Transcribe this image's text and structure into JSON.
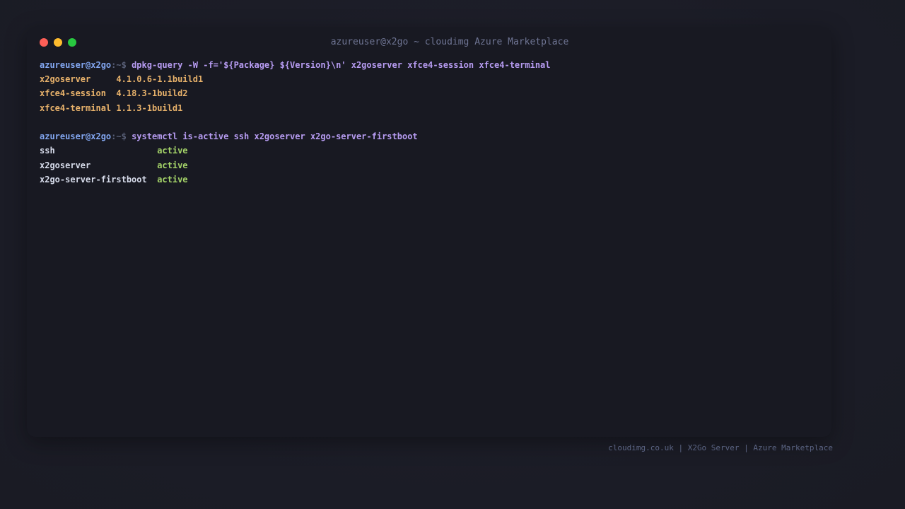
{
  "window": {
    "title": "azureuser@x2go ~ cloudimg Azure Marketplace",
    "controls": {
      "close_color": "#fe5f57",
      "minimize_color": "#febc2e",
      "maximize_color": "#28c840"
    }
  },
  "terminal": {
    "prompt_user": "azureuser@x2go",
    "prompt_path": ":~$",
    "command_1": "dpkg-query -W -f='${Package} ${Version}\\n' x2goserver xfce4-session xfce4-terminal",
    "packages": [
      {
        "name": "x2goserver    ",
        "version": "4.1.0.6-1.1build1"
      },
      {
        "name": "xfce4-session ",
        "version": "4.18.3-1build2"
      },
      {
        "name": "xfce4-terminal",
        "version": "1.1.3-1build1"
      }
    ],
    "command_2": "systemctl is-active ssh x2goserver x2go-server-firstboot",
    "services": [
      {
        "name": "ssh                   ",
        "status": "active"
      },
      {
        "name": "x2goserver            ",
        "status": "active"
      },
      {
        "name": "x2go-server-firstboot ",
        "status": "active"
      }
    ]
  },
  "footer": {
    "text": "cloudimg.co.uk | X2Go Server | Azure Marketplace"
  }
}
